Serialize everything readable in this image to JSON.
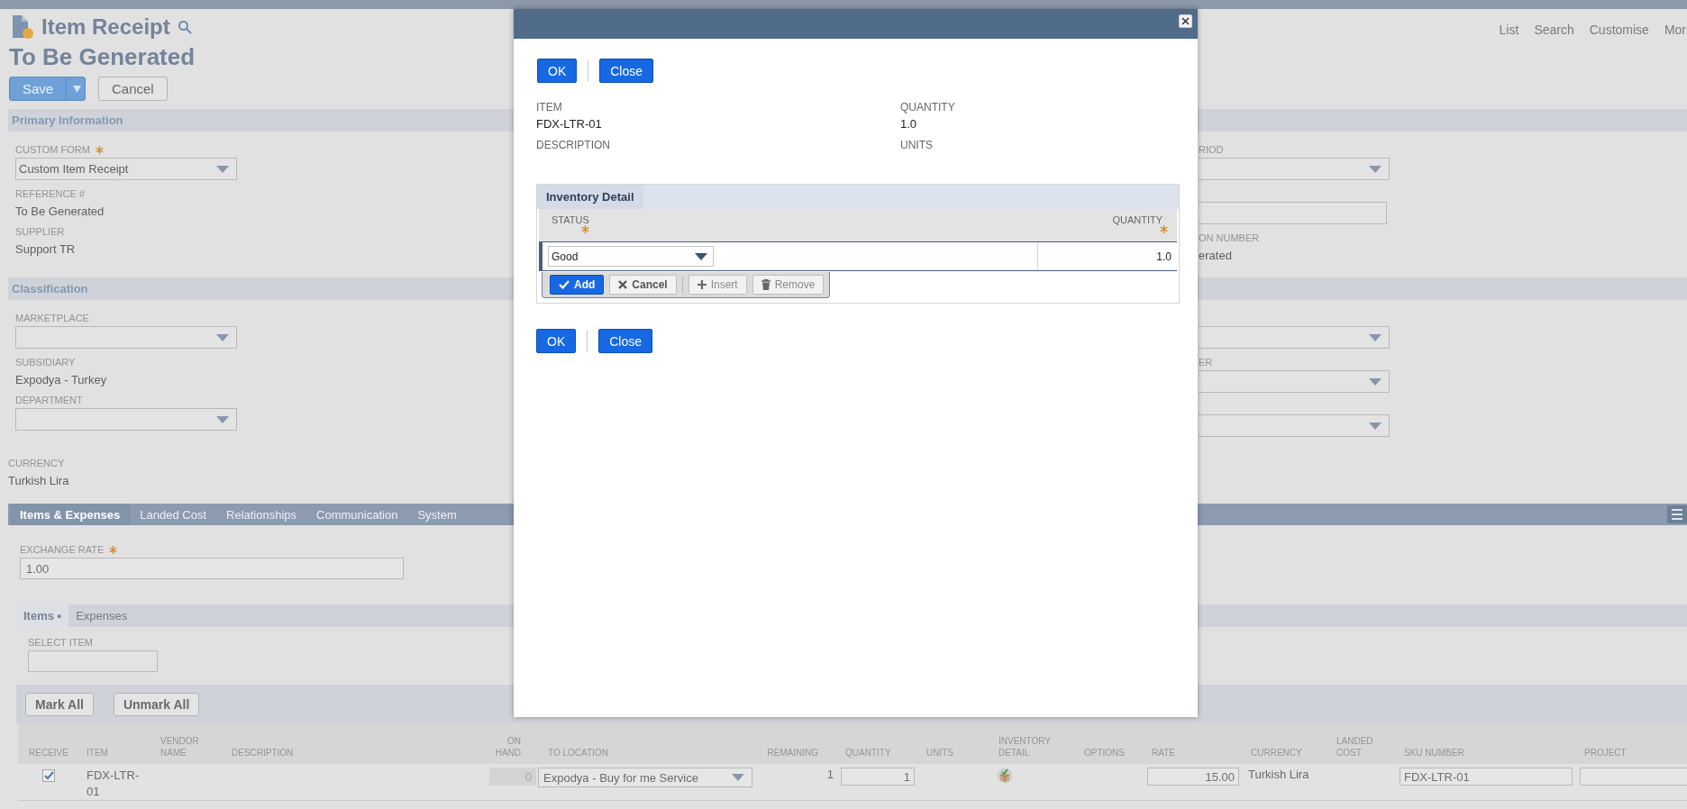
{
  "header_nav": [
    {
      "label": "List"
    },
    {
      "label": "Search"
    },
    {
      "label": "Customise"
    },
    {
      "label": "Mor"
    }
  ],
  "page_title": "Item Receipt",
  "record_title": "To Be Generated",
  "actions": [
    {
      "label": "Save",
      "kind": "primary"
    },
    {
      "label": "Cancel",
      "kind": "secondary"
    }
  ],
  "sections": [
    {
      "title": "Primary Information",
      "left": [
        {
          "label": "CUSTOM FORM",
          "required": true,
          "kind": "select",
          "value": "Custom Item Receipt"
        },
        {
          "label": "REFERENCE #",
          "kind": "text",
          "value": "To Be Generated"
        },
        {
          "label": "SUPPLIER",
          "kind": "text",
          "value": "Support TR"
        }
      ],
      "right": [
        {
          "label": "RIOD",
          "kind": "select"
        },
        {
          "kind": "input"
        },
        {
          "label": "ON NUMBER",
          "kind": "text",
          "value": "erated"
        }
      ]
    },
    {
      "title": "Classification",
      "left": [
        {
          "label": "MARKETPLACE",
          "kind": "select"
        },
        {
          "label": "SUBSIDIARY",
          "kind": "text",
          "value": "Expodya - Turkey"
        },
        {
          "label": "DEPARTMENT",
          "kind": "select"
        }
      ],
      "right": [
        {
          "kind": "select"
        },
        {
          "label": "ER",
          "kind": "select"
        },
        {
          "kind": "select"
        }
      ]
    }
  ],
  "currency": {
    "label": "CURRENCY",
    "value": "Turkish Lira"
  },
  "tabs": [
    {
      "label": "Items & Expenses",
      "selected": true
    },
    {
      "label": "Landed Cost",
      "selected": false
    },
    {
      "label": "Relationships",
      "selected": false
    },
    {
      "label": "Communication",
      "selected": false
    },
    {
      "label": "System",
      "selected": false
    }
  ],
  "exchange_rate": {
    "label": "EXCHANGE RATE",
    "required": true,
    "value": "1.00"
  },
  "subtabs": [
    {
      "label": "Items",
      "marker": "•",
      "selected": true
    },
    {
      "label": "Expenses",
      "selected": false
    }
  ],
  "select_item": {
    "label": "SELECT ITEM"
  },
  "list_buttons": [
    {
      "label": "Mark All"
    },
    {
      "label": "Unmark All"
    }
  ],
  "table": {
    "columns": [
      {
        "label": "RECEIVE"
      },
      {
        "label": "ITEM"
      },
      {
        "label": "VENDOR NAME"
      },
      {
        "label": "DESCRIPTION"
      },
      {
        "label": "ON HAND"
      },
      {
        "label": "TO LOCATION"
      },
      {
        "label": "REMAINING"
      },
      {
        "label": "QUANTITY"
      },
      {
        "label": "UNITS"
      },
      {
        "label": "INVENTORY DETAIL"
      },
      {
        "label": "OPTIONS"
      },
      {
        "label": "RATE"
      },
      {
        "label": "CURRENCY"
      },
      {
        "label": "LANDED COST"
      },
      {
        "label": "SKU NUMBER"
      },
      {
        "label": "PROJECT"
      }
    ],
    "rows": [
      {
        "cells": [
          {
            "kind": "checkbox",
            "checked": true
          },
          {
            "kind": "text",
            "value": "FDX-LTR-01"
          },
          {
            "kind": "empty"
          },
          {
            "kind": "empty"
          },
          {
            "kind": "input",
            "disabled": true,
            "value": "0"
          },
          {
            "kind": "select",
            "value": "Expodya - Buy for me Service"
          },
          {
            "kind": "number",
            "value": "1"
          },
          {
            "kind": "input",
            "disabled": false,
            "value": "1"
          },
          {
            "kind": "empty"
          },
          {
            "kind": "detail"
          },
          {
            "kind": "empty"
          },
          {
            "kind": "input",
            "disabled": false,
            "value": "15.00"
          },
          {
            "kind": "text",
            "value": "Turkish Lira"
          },
          {
            "kind": "empty"
          },
          {
            "kind": "input",
            "disabled": false,
            "value": "FDX-LTR-01"
          },
          {
            "kind": "input",
            "disabled": false
          }
        ]
      }
    ]
  },
  "dialog": {
    "buttons_top": [
      {
        "label": "OK"
      },
      {
        "label": "Close"
      }
    ],
    "fields": [
      {
        "label": "ITEM",
        "value": "FDX-LTR-01"
      },
      {
        "label": "QUANTITY",
        "value": "1.0"
      },
      {
        "label": "DESCRIPTION"
      },
      {
        "label": "UNITS"
      }
    ],
    "sublist": {
      "tab": "Inventory Detail",
      "columns": [
        {
          "label": "STATUS",
          "required": true
        },
        {
          "label": "QUANTITY",
          "required": true
        }
      ],
      "rows": [
        {
          "status": "Good",
          "quantity": "1.0",
          "selected": true
        }
      ],
      "row_buttons": [
        {
          "label": "Add",
          "kind": "add"
        },
        {
          "label": "Cancel",
          "kind": "cancel"
        },
        {
          "label": "Insert",
          "kind": "insert"
        },
        {
          "label": "Remove",
          "kind": "remove"
        }
      ]
    },
    "buttons_bottom": [
      {
        "label": "OK"
      },
      {
        "label": "Close"
      }
    ]
  }
}
